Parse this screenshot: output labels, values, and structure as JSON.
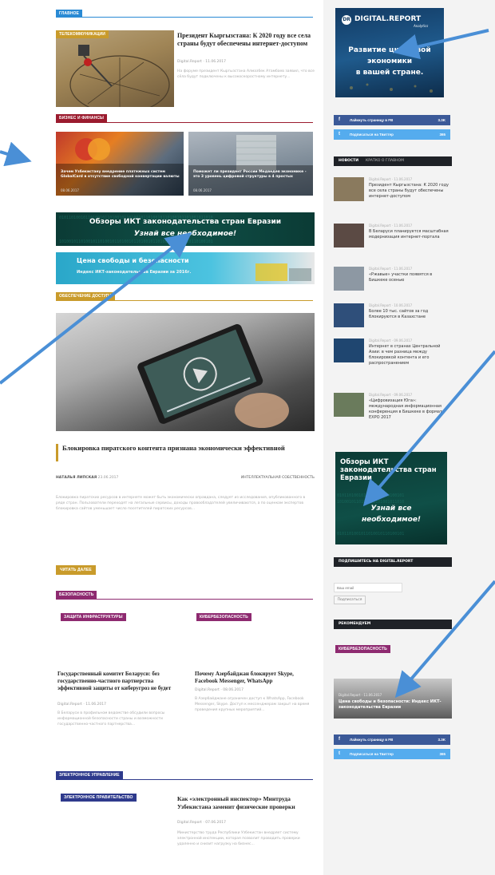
{
  "main": {
    "section_main": "ГЛАВНОЕ",
    "lead": {
      "category": "ТЕЛЕКОММУНИКАЦИИ",
      "title": "Президент Кыргызстана: К 2020 году все села страны будут обеспечены интернет-доступом",
      "meta": "Digital.Report · 11.06.2017",
      "excerpt": "На форуме президент Кыргызстана Алмазбек Атамбаев заявил, что все сёла будут подключены к высокоскоростному интернету..."
    },
    "section_business": "БИЗНЕС И ФИНАНСЫ",
    "biz_cards": [
      {
        "title": "Зачем Узбекистану внедрение платежных систем GlobalCard в отсутствие свободной конвертации валюты",
        "date": "08.06.2017"
      },
      {
        "title": "Поможет ли президент России Медведев экономике - это 3 уровень цифровой структуры в 4 простых",
        "date": "08.06.2017"
      }
    ],
    "banner1": {
      "line1": "Обзоры ИКТ законодательства стран Евразии",
      "line2": "Узнай все необходимое!"
    },
    "banner2": {
      "line1": "Цена свободы и безопасности",
      "line2": "Индекс ИКТ-законодательства Евразии за 2016г."
    },
    "section_security": "ОБЕСПЕЧЕНИЕ ДОСТУПА",
    "feature": {
      "title": "Блокировка пиратского контента признана экономически эффективной",
      "author": "НАТАЛЬЯ ЛИПСКАЯ",
      "date": "23.06.2017",
      "category": "ИНТЕЛЛЕКТУАЛЬНАЯ СОБСТВЕННОСТЬ",
      "excerpt": "Блокировка пиратских ресурсов в интернете может быть экономически оправдана, следует из исследования, опубликованного в ряде стран. Пользователи переходят на легальные сервисы, доходы правообладателей увеличиваются, а по оценкам экспертов блокировка сайтов уменьшает число посетителей пиратских ресурсов...",
      "read_more": "ЧИТАТЬ ДАЛЕЕ"
    },
    "section_cyber": "БЕЗОПАСНОСТЬ",
    "cyber": [
      {
        "tag": "ЗАЩИТА ИНФРАСТРУКТУРЫ",
        "title": "Государственный комитет Беларуси: без государственно-частного партнерства эффективной защиты от киберугроз не будет",
        "meta": "Digital.Report · 11.06.2017",
        "excerpt": "В Беларуси в профильном ведомстве обсудили вопросы информационной безопасности страны и возможности государственно-частного партнерства..."
      },
      {
        "tag": "КИБЕРБЕЗОПАСНОСТЬ",
        "title": "Почему Азербайджан блокирует Skype, Facebook Messenger, WhatsApp",
        "meta": "Digital.Report · 08.06.2017",
        "excerpt": "В Азербайджане ограничен доступ к WhatsApp, Facebook Messenger, Skype. Доступ к мессенджерам закрыт на время проведения крупных мероприятий..."
      }
    ],
    "section_egov": "ЭЛЕКТРОННОЕ УПРАВЛЕНИЕ",
    "egov": {
      "tag": "ЭЛЕКТРОННОЕ ПРАВИТЕЛЬСТВО",
      "title": "Как «электронный инспектор» Минтруда Узбекистана заменит физические проверки",
      "meta": "Digital.Report · 07.06.2017",
      "excerpt": "Министерство труда Республики Узбекистан внедряет систему электронной инспекции, которая позволит проводить проверки удаленно и снизит нагрузку на бизнес..."
    }
  },
  "sidebar": {
    "ad": {
      "brand": "DIGITAL.REPORT",
      "sub": "Analytics",
      "line1": "Развитие цифровой",
      "line2": "экономики",
      "line3": "в вашей стране."
    },
    "social": [
      {
        "label": "Лайкнуть страницу в FB",
        "count": "3.3K",
        "color": "#3b5998",
        "icon": "f"
      },
      {
        "label": "Подписаться на Твиттер",
        "count": "365",
        "color": "#55acee",
        "icon": "t"
      }
    ],
    "tabs": {
      "news": "НОВОСТИ",
      "brief": "КРАТКО О ГЛАВНОМ"
    },
    "news": [
      {
        "meta": "Digital.Report · 11.06.2017",
        "title": "Президент Кыргызстана: К 2020 году все села страны будут обеспечены интернет-доступом",
        "thumb": "#8a7a5e"
      },
      {
        "meta": "Digital.Report · 11.06.2017",
        "title": "В Беларуси планируется масштабная модернизация интернет-портала",
        "thumb": "#5b4a44"
      },
      {
        "meta": "Digital.Report · 11.06.2017",
        "title": "«Ржавые» участки появятся в Бишкеке осенью",
        "thumb": "#8d98a3"
      },
      {
        "meta": "Digital.Report · 10.06.2017",
        "title": "Более 10 тыс. сайтов за год блокируются в Казахстане",
        "thumb": "#2f4f7a"
      },
      {
        "meta": "Digital.Report · 09.06.2017",
        "title": "Интернет в странах Центральной Азии: в чем разница между блокировкой контента и его распространением",
        "thumb": "#1f4670"
      },
      {
        "meta": "Digital.Report · 09.06.2017",
        "title": "«Цифровизация Юга»: международная информационная конференция в Бишкеке в формате EXPO 2017",
        "thumb": "#6a7b5c"
      }
    ],
    "ad2": {
      "line1": "Обзоры ИКТ законодательства стран Евразии",
      "line2": "Узнай все",
      "line3": "необходимое!"
    },
    "subscribe": {
      "header": "ПОДПИШИТЕСЬ НА DIGITAL.REPORT",
      "placeholder": "Ваш email",
      "button": "Подписаться"
    },
    "recommended": {
      "header": "РЕКОМЕНДУЕМ",
      "tag": "КИБЕРБЕЗОПАСНОСТЬ",
      "meta": "Digital.Report · 11.06.2017",
      "title": "Цена свободы и безопасности: Индекс ИКТ-законодательства Евразии"
    }
  }
}
